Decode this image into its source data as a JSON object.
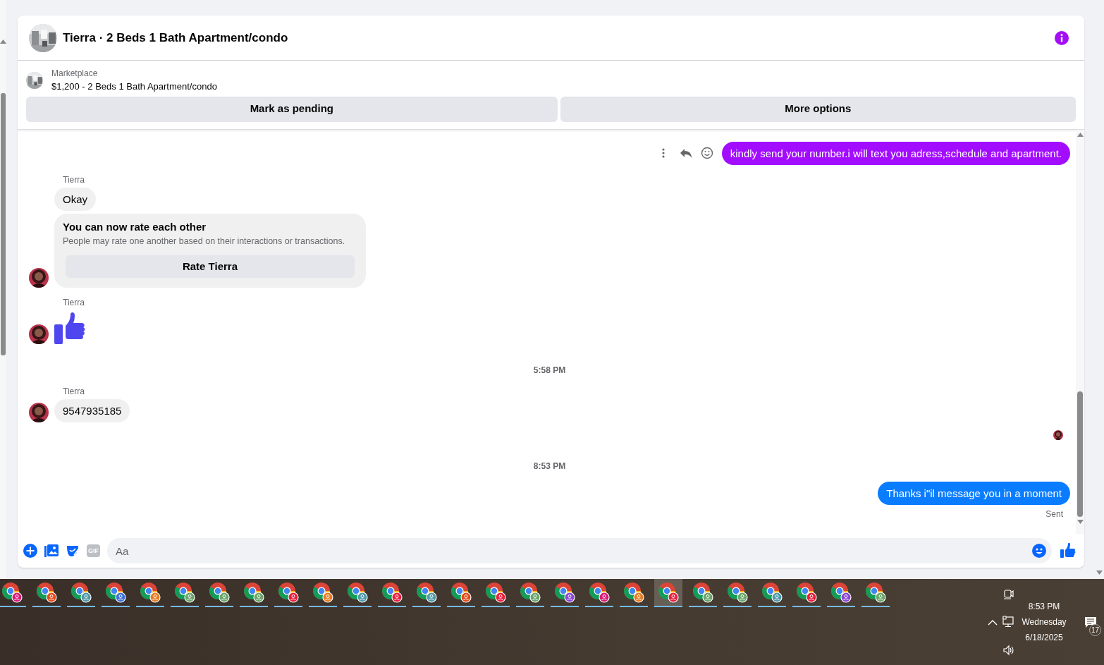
{
  "conversation": {
    "title": "Tierra · 2 Beds 1 Bath Apartment/condo"
  },
  "listing": {
    "source": "Marketplace",
    "summary": "$1,200 - 2 Beds 1 Bath Apartment/condo",
    "buttons": [
      "Mark as pending",
      "More options"
    ]
  },
  "messages": [
    {
      "kind": "outgoing",
      "text": "kindly send your number.i will text you adress,schedule and apartment.",
      "color": "#a20cff",
      "actions": true
    },
    {
      "kind": "incoming",
      "sender": "Tierra",
      "items": [
        {
          "kind": "text",
          "text": "Okay"
        },
        {
          "kind": "rating",
          "title": "You can now rate each other",
          "description": "People may rate one another based on their interactions or transactions.",
          "button": "Rate Tierra"
        }
      ]
    },
    {
      "kind": "incoming",
      "sender": "Tierra",
      "items": [
        {
          "kind": "like"
        }
      ]
    },
    {
      "kind": "timestamp",
      "text": "5:58 PM"
    },
    {
      "kind": "incoming",
      "sender": "Tierra",
      "items": [
        {
          "kind": "text",
          "text": "9547935185"
        }
      ]
    },
    {
      "kind": "seen"
    },
    {
      "kind": "timestamp",
      "text": "8:53 PM"
    },
    {
      "kind": "outgoing",
      "text": "Thanks i\"il message you in a moment",
      "color": "#0a7cff",
      "actions": false,
      "status": "Sent"
    }
  ],
  "composer": {
    "gif_label": "GIF",
    "placeholder": "Aa"
  },
  "taskbar": {
    "apps": [
      {
        "color": "#d81b78",
        "selected": false
      },
      {
        "color": "#e64a19",
        "selected": false
      },
      {
        "color": "#4f9aa8",
        "selected": false
      },
      {
        "color": "#3f6fd8",
        "selected": false
      },
      {
        "color": "#e67c22",
        "selected": false
      },
      {
        "color": "#6aa56a",
        "selected": false
      },
      {
        "color": "#6aa56a",
        "selected": false
      },
      {
        "color": "#6aa56a",
        "selected": false
      },
      {
        "color": "#e91e3c",
        "selected": false
      },
      {
        "color": "#e67c22",
        "selected": false
      },
      {
        "color": "#4f9aa8",
        "selected": false
      },
      {
        "color": "#e91e3c",
        "selected": false
      },
      {
        "color": "#4f9aa8",
        "selected": false
      },
      {
        "color": "#e64a19",
        "selected": false
      },
      {
        "color": "#e91e3c",
        "selected": false
      },
      {
        "color": "#6aa56a",
        "selected": false
      },
      {
        "color": "#8e44d8",
        "selected": false
      },
      {
        "color": "#d81b78",
        "selected": false
      },
      {
        "color": "#e67c22",
        "selected": false
      },
      {
        "color": "#e91e3c",
        "selected": true
      },
      {
        "color": "#6aa56a",
        "selected": false
      },
      {
        "color": "#6aa56a",
        "selected": false
      },
      {
        "color": "#4f9aa8",
        "selected": false
      },
      {
        "color": "#e91e3c",
        "selected": false
      },
      {
        "color": "#8e44d8",
        "selected": false
      },
      {
        "color": "#6aa56a",
        "selected": false
      }
    ],
    "time": "8:53 PM",
    "day": "Wednesday",
    "date": "6/18/2025",
    "notifications": "17"
  }
}
